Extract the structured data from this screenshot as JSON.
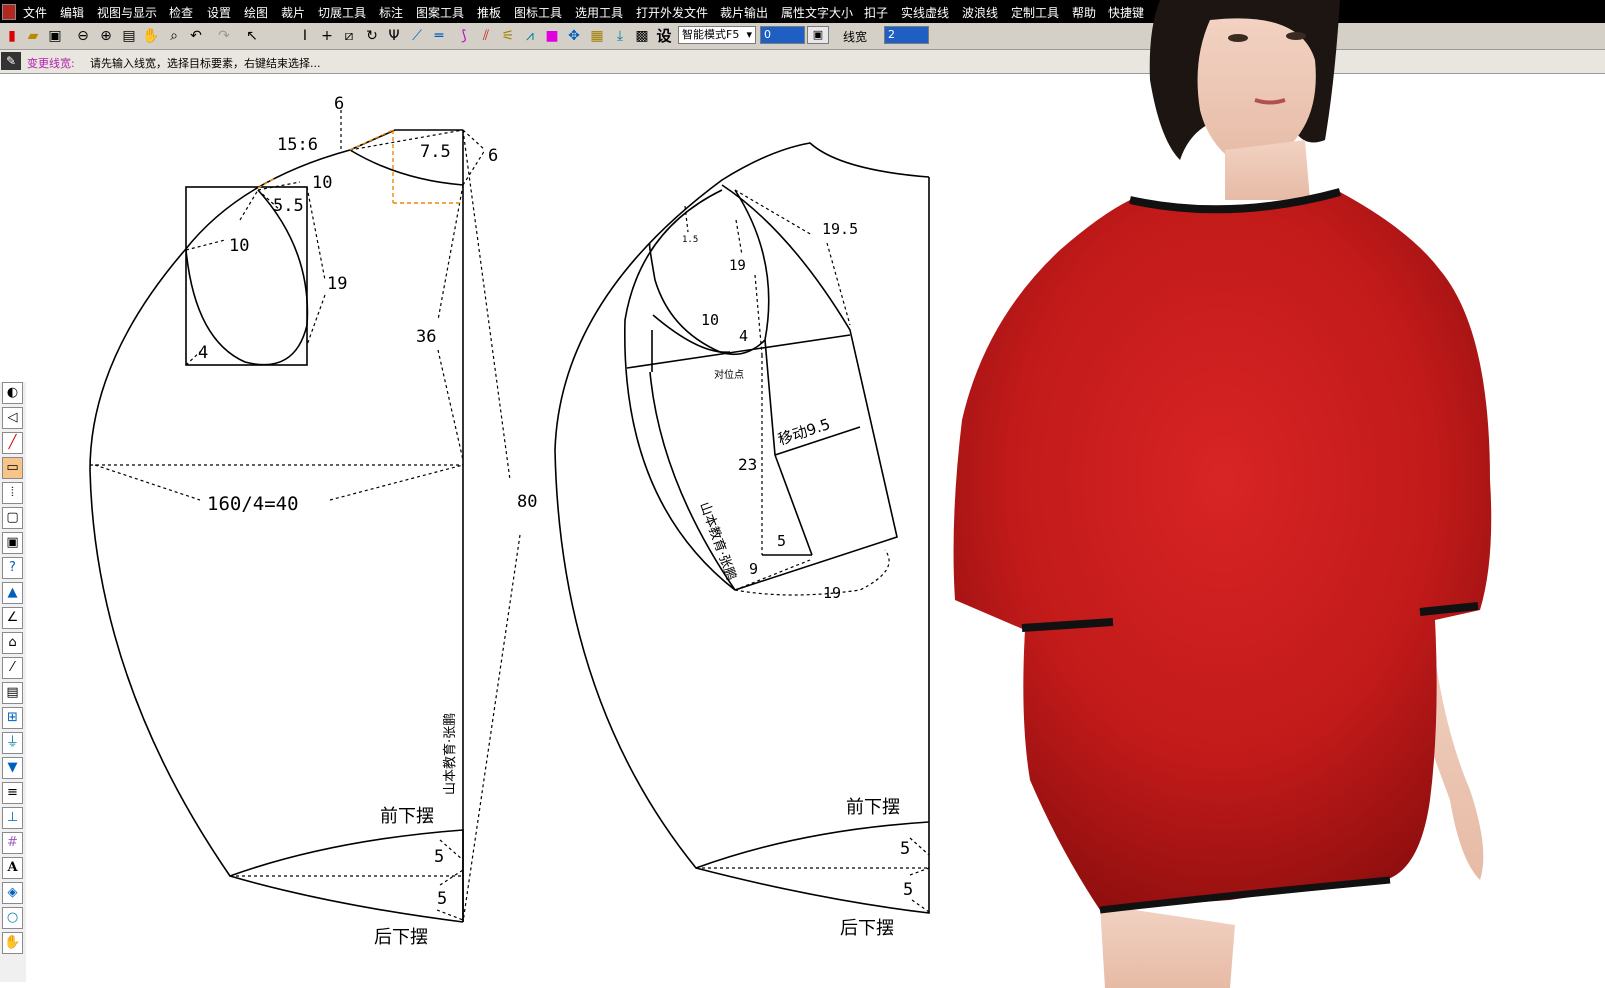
{
  "menubar": {
    "items": [
      "文件",
      "编辑",
      "视图与显示",
      "检查",
      "设置",
      "绘图",
      "裁片",
      "切展工具",
      "标注",
      "图案工具",
      "推板",
      "图标工具",
      "选用工具",
      "打开外发文件",
      "裁片输出",
      "属性文字大小",
      "扣子",
      "实线虚线",
      "波浪线",
      "定制工具",
      "帮助",
      "快捷键"
    ]
  },
  "toolbar": {
    "mode_select": "智能模式F5",
    "field1_value": "0",
    "linewidth_label": "线宽",
    "linewidth_value": "2",
    "setting_label": "设"
  },
  "status": {
    "label": "变更线宽:",
    "message": "请先输入线宽，选择目标要素，右键结束选择..."
  },
  "pattern": {
    "front": {
      "top_6": "6",
      "neck_15_6": "15:6",
      "shoulder_7_5": "7.5",
      "right_6": "6",
      "neck_10": "10",
      "pocket_5_5": "5.5",
      "pocket_10": "10",
      "pocket_19": "19",
      "pocket_4": "4",
      "length_36": "36",
      "bust_label": "160/4=40",
      "total_80": "80",
      "brand_vertical": "山本教育·张鹏",
      "front_hem": "前下摆",
      "hem_5a": "5",
      "hem_5b": "5",
      "back_hem": "后下摆"
    },
    "sleeve": {
      "d_19_5": "19.5",
      "d_1_5": "1.5",
      "d_19a": "19",
      "d_10": "10",
      "d_4": "4",
      "align_mark": "对位点",
      "move_label": "移动9.5",
      "d_23": "23",
      "brand_vertical": "山本教育·张鹏",
      "d_9": "9",
      "d_5": "5",
      "d_19b": "19",
      "front_hem": "前下摆",
      "hem_5a": "5",
      "hem_5b": "5",
      "back_hem": "后下摆"
    }
  },
  "colors": {
    "dress_red": "#c21a1a",
    "trim_black": "#111111",
    "status_label": "#b020b0",
    "guide_orange": "#f08a00"
  }
}
